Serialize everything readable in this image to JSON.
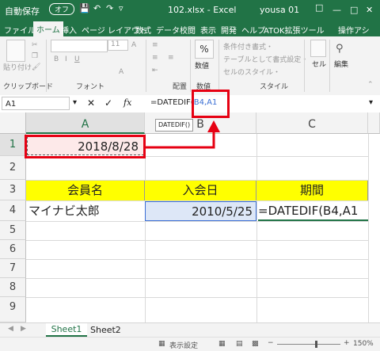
{
  "titlebar": {
    "autosave": "自動保存",
    "autosave_state": "オフ",
    "filename": "102.xlsx  -  Excel",
    "user": "yousa 01"
  },
  "tabs": [
    "ファイル",
    "ホーム",
    "挿入",
    "ページ レイアウト",
    "数式",
    "データ",
    "校閲",
    "表示",
    "開発",
    "ヘルプ",
    "ATOK拡張ツール",
    "操作アシ"
  ],
  "ribbon": {
    "paste": "貼り付け",
    "clipboard": "クリップボード",
    "font_label": "フォント",
    "font_size": "11",
    "align_label": "配置",
    "number_label": "数値",
    "percent": "%",
    "cond_format": "条件付き書式・",
    "table_format": "テーブルとして書式設定・",
    "cell_style": "セルのスタイル・",
    "style_label": "スタイル",
    "cells": "セル",
    "edit": "編集"
  },
  "formula_bar": {
    "name_box": "A1",
    "formula_prefix": "=DATEDIF(",
    "formula_ref": "B4,A1",
    "tooltip": "DATEDIF()"
  },
  "columns": [
    "A",
    "B",
    "C"
  ],
  "rows": [
    "1",
    "2",
    "3",
    "4",
    "5",
    "6",
    "7",
    "8",
    "9"
  ],
  "cells": {
    "a1": "2018/8/28",
    "a3": "会員名",
    "b3": "入会日",
    "c3": "期間",
    "a4": "マイナビ太郎",
    "b4": "2010/5/25",
    "c4": "=DATEDIF(B4,A1"
  },
  "sheets": [
    "Sheet1",
    "Sheet2"
  ],
  "status": {
    "display_settings": "表示設定",
    "zoom": "150%"
  },
  "colors": {
    "excel_green": "#217346",
    "header_fill": "#ffff00",
    "red": "#e60012",
    "range_blue": "#dde7f7"
  }
}
